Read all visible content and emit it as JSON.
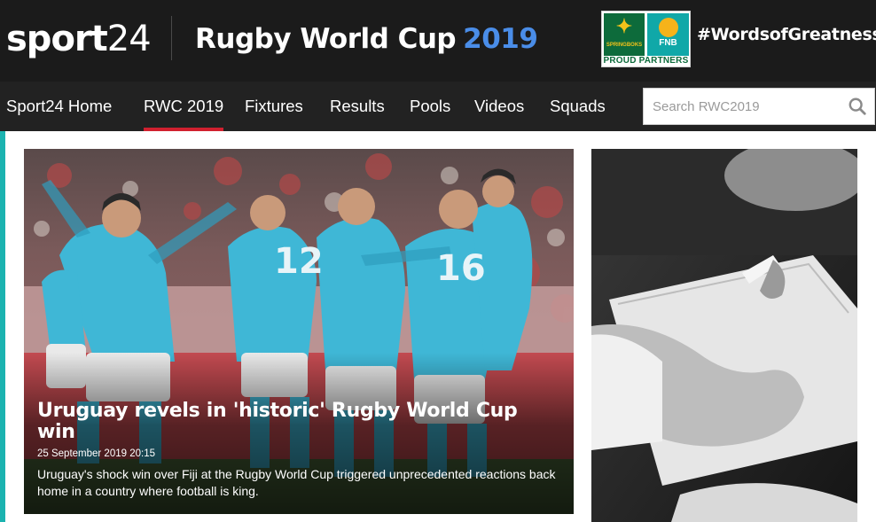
{
  "brand": {
    "logo_word": "sport",
    "logo_number": "24"
  },
  "header": {
    "section_title": "Rugby World Cup",
    "section_year": "2019",
    "partner": {
      "logo_left_text": "SPRINGBOKS",
      "logo_right_text": "FNB",
      "caption": "PROUD PARTNERS"
    },
    "hashtag": "#WordsofGreatness"
  },
  "nav": {
    "items": [
      {
        "label": "Sport24 Home",
        "active": false
      },
      {
        "label": "RWC 2019",
        "active": true
      },
      {
        "label": "Fixtures",
        "active": false
      },
      {
        "label": "Results",
        "active": false
      },
      {
        "label": "Pools",
        "active": false
      },
      {
        "label": "Videos",
        "active": false
      },
      {
        "label": "Squads",
        "active": false
      }
    ],
    "search": {
      "placeholder": "Search RWC2019",
      "icon": "search-icon"
    }
  },
  "hero_article": {
    "title": "Uruguay revels in 'historic' Rugby World Cup win",
    "date": "25 September 2019 20:15",
    "summary": "Uruguay's shock win over Fiji at the Rugby World Cup triggered unprecedented reactions back home in a country where football is king.",
    "image": "rugby-players-celebrating-photo",
    "jersey_numbers": [
      "12",
      "16"
    ]
  },
  "side_article": {
    "image": "hand-writing-on-notepad-photo"
  },
  "colors": {
    "header_bg": "#1b1b1b",
    "nav_bg": "#222222",
    "accent_blue": "#4a8de8",
    "active_underline": "#d1202f",
    "side_accent": "#1bb3b0"
  }
}
